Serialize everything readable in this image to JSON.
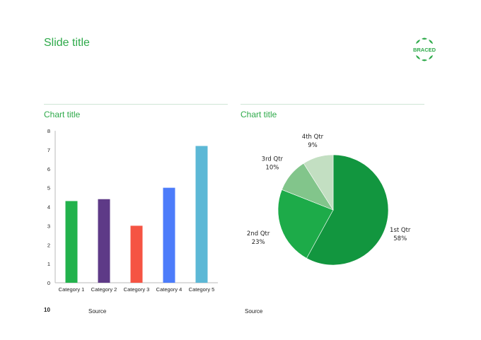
{
  "slide": {
    "title": "Slide title",
    "page_number": "10",
    "logo_text": "BRACED"
  },
  "colors": {
    "accent": "#2eaa4a",
    "rule": "#cfe6d6"
  },
  "chart_data": [
    {
      "type": "bar",
      "title": "Chart title",
      "source": "Source",
      "categories": [
        "Category 1",
        "Category 2",
        "Category 3",
        "Category 4",
        "Category 5"
      ],
      "values": [
        4.3,
        4.4,
        3.0,
        5.0,
        7.2
      ],
      "colors": [
        "#22b24c",
        "#5e3a87",
        "#f55443",
        "#4c7cfa",
        "#5cb8d6"
      ],
      "ylim": [
        0,
        8
      ],
      "yticks": [
        "0",
        "1",
        "2",
        "3",
        "4",
        "5",
        "6",
        "7",
        "8"
      ],
      "grid": false,
      "legend": "none"
    },
    {
      "type": "pie",
      "title": "Chart title",
      "source": "Source",
      "slices": [
        {
          "label": "1st Qtr",
          "percent_label": "58%",
          "value": 58,
          "color": "#12963f"
        },
        {
          "label": "2nd Qtr",
          "percent_label": "23%",
          "value": 23,
          "color": "#1dab49"
        },
        {
          "label": "3rd Qtr",
          "percent_label": "10%",
          "value": 10,
          "color": "#82c58b"
        },
        {
          "label": "4th Qtr",
          "percent_label": "9%",
          "value": 9,
          "color": "#c3dfc2"
        }
      ],
      "legend": "none"
    }
  ]
}
